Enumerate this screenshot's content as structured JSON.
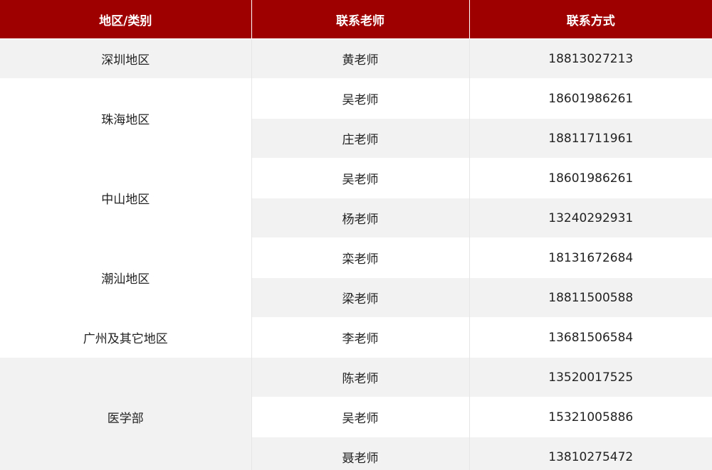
{
  "header": {
    "region": "地区/类别",
    "teacher": "联系老师",
    "contact": "联系方式"
  },
  "colors": {
    "header_bg": "#9e0000",
    "header_text": "#ffffff",
    "row_shade": "#f2f2f2",
    "row_plain": "#ffffff"
  },
  "groups": [
    {
      "region": "深圳地区",
      "rows": [
        {
          "teacher": "黄老师",
          "phone": "18813027213"
        }
      ]
    },
    {
      "region": "珠海地区",
      "rows": [
        {
          "teacher": "吴老师",
          "phone": "18601986261"
        },
        {
          "teacher": "庄老师",
          "phone": "18811711961"
        }
      ]
    },
    {
      "region": "中山地区",
      "rows": [
        {
          "teacher": "吴老师",
          "phone": "18601986261"
        },
        {
          "teacher": "杨老师",
          "phone": "13240292931"
        }
      ]
    },
    {
      "region": "潮汕地区",
      "rows": [
        {
          "teacher": "栾老师",
          "phone": "18131672684"
        },
        {
          "teacher": "梁老师",
          "phone": "18811500588"
        }
      ]
    },
    {
      "region": "广州及其它地区",
      "rows": [
        {
          "teacher": "李老师",
          "phone": "13681506584"
        }
      ]
    },
    {
      "region": "医学部",
      "rows": [
        {
          "teacher": "陈老师",
          "phone": "13520017525"
        },
        {
          "teacher": "吴老师",
          "phone": "15321005886"
        },
        {
          "teacher": "聂老师",
          "phone": "13810275472"
        }
      ]
    }
  ]
}
